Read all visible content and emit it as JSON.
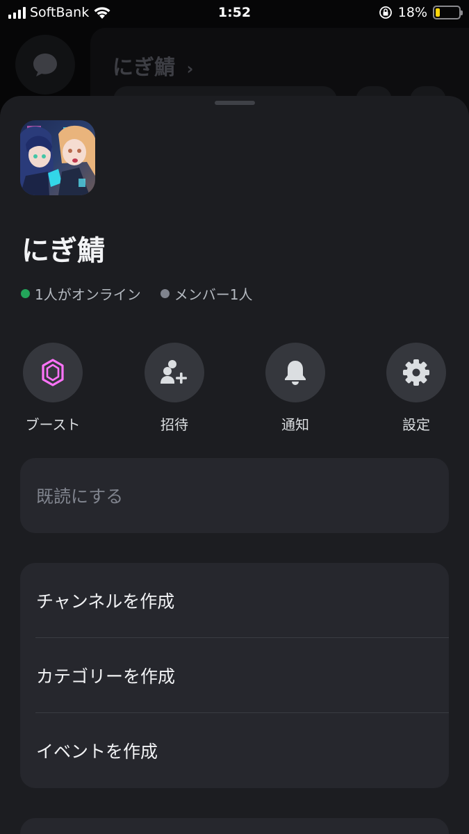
{
  "status_bar": {
    "carrier": "SoftBank",
    "time": "1:52",
    "battery_percent": "18%",
    "battery_level": 0.18,
    "battery_color": "#ffd60a"
  },
  "background": {
    "server_title": "にぎ鯖",
    "chevron": "›"
  },
  "server": {
    "name": "にぎ鯖",
    "online_text": "1人がオンライン",
    "members_text": "メンバー1人",
    "online_color": "#23a55a"
  },
  "actions": [
    {
      "label": "ブースト",
      "icon": "boost-gem-icon",
      "color": "#ff73fa"
    },
    {
      "label": "招待",
      "icon": "invite-person-plus-icon"
    },
    {
      "label": "通知",
      "icon": "bell-icon"
    },
    {
      "label": "設定",
      "icon": "gear-icon"
    }
  ],
  "menu": {
    "mark_read": "既読にする",
    "create_channel": "チャンネルを作成",
    "create_category": "カテゴリーを作成",
    "create_event": "イベントを作成"
  }
}
